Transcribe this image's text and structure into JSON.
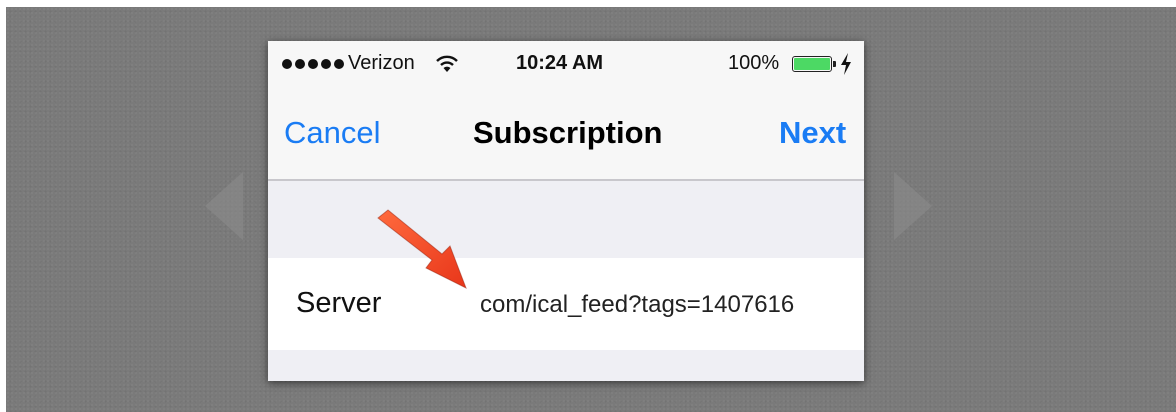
{
  "status_bar": {
    "carrier": "Verizon",
    "time": "10:24 AM",
    "battery_percent_label": "100%",
    "battery_level": 1.0,
    "signal_bars": 5,
    "wifi_icon": "wifi-icon",
    "charging_icon": "lightning-bolt-icon"
  },
  "nav_bar": {
    "cancel_label": "Cancel",
    "title": "Subscription",
    "next_label": "Next"
  },
  "form": {
    "server_label": "Server",
    "server_value": "com/ical_feed?tags=1407616"
  },
  "annotation": {
    "arrow_icon": "red-pointer-arrow-icon",
    "arrow_color": "#f24a26"
  },
  "colors": {
    "accent": "#1a7cf4",
    "backdrop": "#7a7a7a",
    "battery_fill": "#4cd964"
  }
}
